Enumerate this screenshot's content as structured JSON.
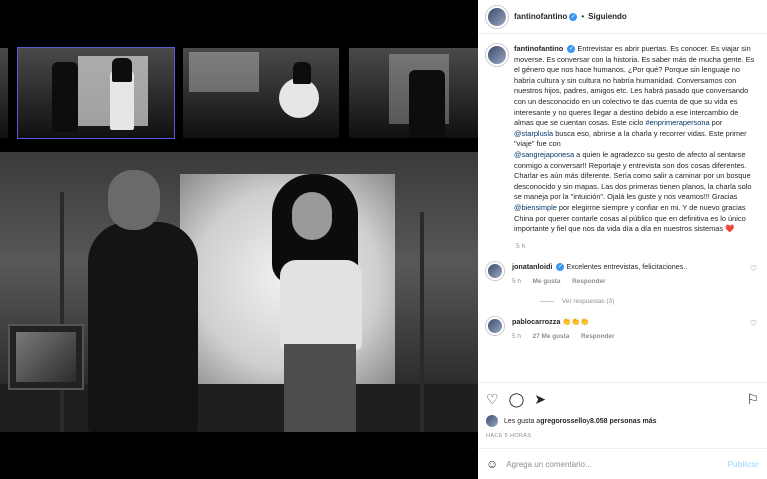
{
  "header": {
    "username": "fantinofantino",
    "separator": "•",
    "follow_label": "Siguiendo"
  },
  "post": {
    "username": "fantinofantino",
    "caption_part1": "Entrevistar es abrir puertas. Es conocer. Es viajar sin moverse. Es conversar con la historia. Es saber más de mucha gente. Es el género que nos hace humanos. ¿Por qué? Porque sin lenguaje no habría cultura y sin cultura no habría humanidad. Conversamos con nuestros hijos, padres, amigos etc. Les habrá pasado que conversando con un desconocido en un colectivo te das cuenta de que su vida es interesante y no queres llegar a destino debido a ese intercambio de almas que se cuentan cosas. Este ciclo ",
    "hashtag": "#enprimerapersona",
    "caption_part2": " por ",
    "mention1": "@starplusla",
    "caption_part3": " busca eso, abrirse a la charla y recorrer vidas. Este primer \"viaje\" fue con ",
    "mention2": "@sangrejaponesa",
    "caption_part4": " a quien le agradezco su gesto de afecto al sentarse conmigo a conversar!! Reportaje y entrevista son dos cosas diferentes. Charlar es aún más diferente. Sería como salir a caminar por un bosque desconocido y sin mapas. Las dos primeras tienen planos, la charla solo se maneja por la \"intuición\". Ojalá les guste y nos veamos!!! Gracias ",
    "mention3": "@biensimple",
    "caption_part5": " por elegirme siempre y confiar en mi. Y de nuevo gracias China por querer contarle cosas al público que en definitiva es lo único importante y fiel que nos da vida día a día en nuestros sistemas ",
    "heart": "❤️",
    "time": "5 h"
  },
  "comments": [
    {
      "username": "jonatanloidi",
      "text": "Excelentes entrevistas, felicitaciones..",
      "time": "5 h",
      "likes": "Me gusta",
      "reply": "Responder",
      "view_replies": "Ver respuestas (3)"
    },
    {
      "username": "pablocarrozza",
      "text": "👏👏👏",
      "time": "5 h",
      "likes": "27 Me gusta",
      "reply": "Responder"
    }
  ],
  "likes": {
    "prefix": "Les gusta a ",
    "user": "gregorossello",
    "conj": " y ",
    "count": "8.058 personas más"
  },
  "ago": "HACE 5 HORAS",
  "comment_box": {
    "placeholder": "Agrega un comentario...",
    "publish": "Publicar"
  },
  "icons": {
    "like": "heart-icon",
    "comment": "comment-icon",
    "share": "share-icon",
    "save": "bookmark-icon",
    "emoji": "emoji-icon"
  }
}
